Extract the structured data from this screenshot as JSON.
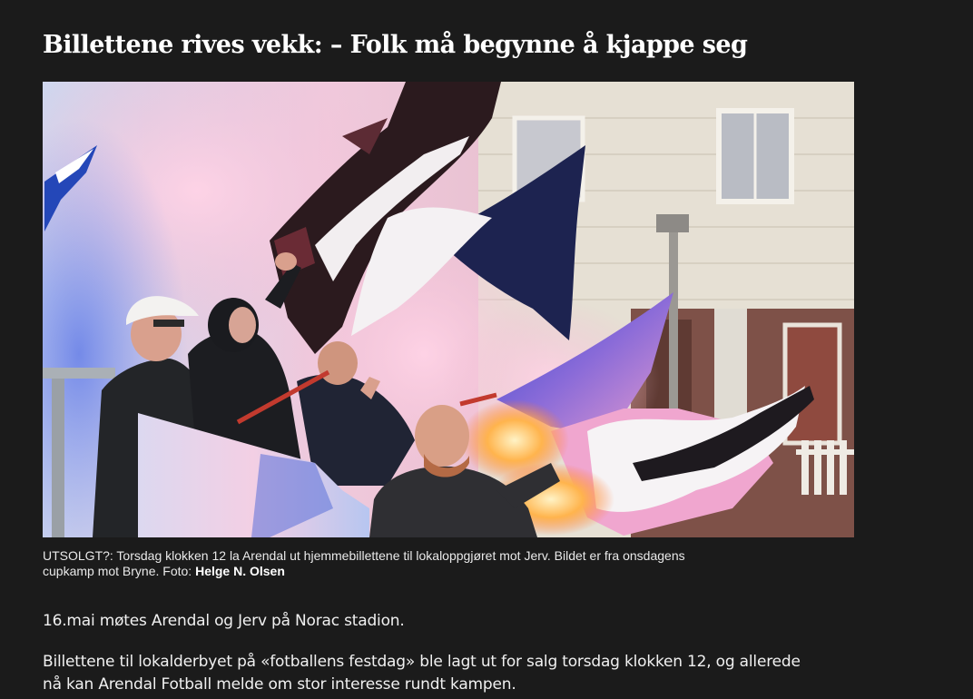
{
  "article": {
    "headline": "Billettene rives vekk: – Folk må begynne å kjappe seg",
    "image": {
      "caption_line1": "UTSOLGT?: Torsdag klokken 12 la Arendal ut hjemmebillettene til lokaloppgjøret mot Jerv. Bildet er fra onsdagens",
      "caption_line2_prefix": "cupkamp mot Bryne. Foto: ",
      "photographer": "Helge N. Olsen"
    },
    "paragraphs": [
      {
        "lines": [
          "16.mai møtes Arendal og Jerv på Norac stadion."
        ]
      },
      {
        "lines": [
          "Billettene til lokalderbyet på «fotballens festdag» ble lagt ut for salg torsdag klokken 12, og allerede",
          "nå kan Arendal Fotball melde om stor interesse rundt kampen."
        ]
      }
    ]
  }
}
